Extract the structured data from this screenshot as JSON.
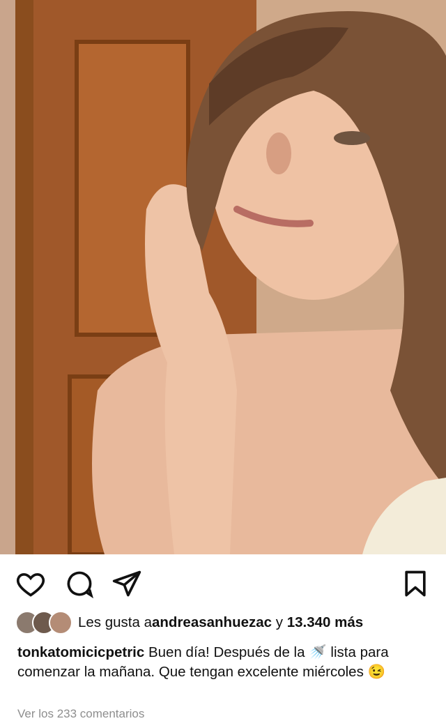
{
  "post": {
    "likes": {
      "prefix": "Les gusta a ",
      "user": "andreasanhuezac",
      "joiner": " y ",
      "count": "13.340 más"
    },
    "caption": {
      "username": "tonkatomicicpetric",
      "text_part1": " Buen día! Después de la ",
      "shower_emoji": "🚿",
      "text_part2": " lista para comenzar la mañana. Que tengan excelente miércoles ",
      "wink_emoji": "😉"
    },
    "footer_text": "Ver los 233 comentarios"
  },
  "icons": {
    "like": "heart-icon",
    "comment": "comment-icon",
    "share": "send-icon",
    "save": "bookmark-icon"
  },
  "colors": {
    "text": "#111111",
    "muted": "#8e8e8e",
    "background": "#ffffff"
  }
}
